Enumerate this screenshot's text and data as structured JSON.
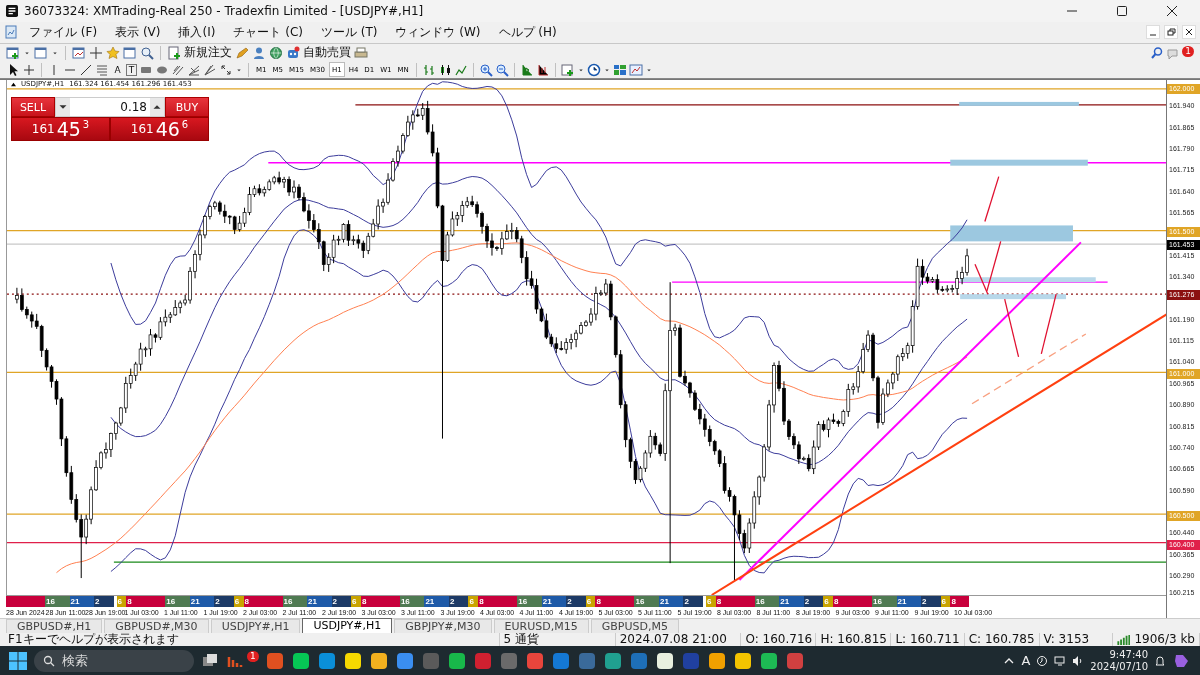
{
  "window": {
    "title": "36073324: XMTrading-Real 250 - Tradexfin Limited - [USDJPY#,H1]"
  },
  "menu": [
    "ファイル (F)",
    "表示 (V)",
    "挿入(I)",
    "チャート (C)",
    "ツール (T)",
    "ウィンドウ (W)",
    "ヘルプ (H)"
  ],
  "toolbar": {
    "new_order": "新規注文",
    "auto_trading": "自動売買",
    "notification_count": "1"
  },
  "tools": {
    "text_tool": "A",
    "label_tool": "T"
  },
  "timeframes": [
    {
      "label": "M1",
      "selected": false
    },
    {
      "label": "M5",
      "selected": false
    },
    {
      "label": "M15",
      "selected": false
    },
    {
      "label": "M30",
      "selected": false
    },
    {
      "label": "H1",
      "selected": true
    },
    {
      "label": "H4",
      "selected": false
    },
    {
      "label": "D1",
      "selected": false
    },
    {
      "label": "W1",
      "selected": false
    },
    {
      "label": "MN",
      "selected": false
    }
  ],
  "chart": {
    "header": {
      "symbol": "USDJPY#,H1",
      "ohlc": "161.324 161.454 161.296 161.453"
    },
    "trade_panel": {
      "sell": "SELL",
      "buy": "BUY",
      "lot": "0.18",
      "sell_price": {
        "prefix": "161",
        "main": "45",
        "suffix": "3"
      },
      "buy_price": {
        "prefix": "161",
        "main": "46",
        "suffix": "6"
      }
    },
    "price_labels": [
      "161.940",
      "161.865",
      "161.790",
      "161.715",
      "161.640",
      "161.565",
      "161.415",
      "161.340",
      "161.190",
      "161.115",
      "161.040",
      "160.965",
      "160.890",
      "160.815",
      "160.740",
      "160.665",
      "160.590",
      "160.440",
      "160.365",
      "160.290",
      "160.215"
    ],
    "levels": [
      {
        "label": "162.000",
        "color": "#e0a526",
        "kind": "solid"
      },
      {
        "label": "161.500",
        "color": "#e0a526",
        "kind": "solid"
      },
      {
        "label": "161.453",
        "color": "#000000",
        "kind": "bid"
      },
      {
        "label": "161.276",
        "color": "#8b1010",
        "kind": "dotted"
      },
      {
        "label": "161.000",
        "color": "#e0a526",
        "kind": "solid"
      },
      {
        "label": "160.500",
        "color": "#e0a526",
        "kind": "solid"
      },
      {
        "label": "160.400",
        "color": "#e0204a",
        "kind": "solid"
      }
    ],
    "time_labels": [
      "28 Jun 2024",
      "28 Jun 11:00",
      "28 Jun 19:00",
      "1 Jul 03:00",
      "1 Jul 11:00",
      "1 Jul 19:00",
      "2 Jul 03:00",
      "2 Jul 11:00",
      "2 Jul 19:00",
      "3 Jul 03:00",
      "3 Jul 11:00",
      "3 Jul 19:00",
      "4 Jul 03:00",
      "4 Jul 11:00",
      "4 Jul 19:00",
      "5 Jul 03:00",
      "5 Jul 11:00",
      "5 Jul 19:00",
      "8 Jul 03:00",
      "8 Jul 11:00",
      "8 Jul 19:00",
      "9 Jul 03:00",
      "9 Jul 11:00",
      "9 Jul 19:00",
      "10 Jul 03:00"
    ],
    "sessions": [
      {
        "kind": "eu",
        "color": "#c8003c"
      },
      {
        "kind": "us",
        "color": "#4f7a52",
        "label": "16"
      },
      {
        "kind": "late",
        "color": "#1e5aa8",
        "label": "21"
      },
      {
        "kind": "asia",
        "color": "#1d3a66",
        "label": "2"
      },
      {
        "kind": "gap"
      },
      {
        "kind": "pre",
        "color": "#c9a400",
        "label": "6"
      },
      {
        "kind": "eu",
        "color": "#c8003c",
        "label": "8"
      },
      {
        "kind": "us",
        "color": "#4f7a52",
        "label": "16"
      },
      {
        "kind": "late",
        "color": "#1e5aa8",
        "label": "21"
      },
      {
        "kind": "asia",
        "color": "#1d3a66",
        "label": "2"
      },
      {
        "kind": "pre",
        "color": "#c9a400",
        "label": "6"
      },
      {
        "kind": "eu",
        "color": "#c8003c",
        "label": "8"
      },
      {
        "kind": "us",
        "color": "#4f7a52",
        "label": "16"
      },
      {
        "kind": "late",
        "color": "#1e5aa8",
        "label": "21"
      },
      {
        "kind": "asia",
        "color": "#1d3a66",
        "label": "2"
      },
      {
        "kind": "pre",
        "color": "#c9a400",
        "label": "6"
      },
      {
        "kind": "eu",
        "color": "#c8003c",
        "label": "8"
      },
      {
        "kind": "us",
        "color": "#4f7a52",
        "label": "16"
      },
      {
        "kind": "late",
        "color": "#1e5aa8",
        "label": "21"
      },
      {
        "kind": "asia",
        "color": "#1d3a66",
        "label": "2"
      },
      {
        "kind": "pre",
        "color": "#c9a400",
        "label": "6"
      },
      {
        "kind": "eu",
        "color": "#c8003c",
        "label": "8"
      },
      {
        "kind": "us",
        "color": "#4f7a52",
        "label": "16"
      },
      {
        "kind": "late",
        "color": "#1e5aa8",
        "label": "21"
      },
      {
        "kind": "asia",
        "color": "#1d3a66",
        "label": "2"
      },
      {
        "kind": "pre",
        "color": "#c9a400",
        "label": "6"
      },
      {
        "kind": "eu",
        "color": "#c8003c",
        "label": "8"
      },
      {
        "kind": "us",
        "color": "#4f7a52",
        "label": "16"
      },
      {
        "kind": "late",
        "color": "#1e5aa8",
        "label": "21"
      },
      {
        "kind": "asia",
        "color": "#1d3a66",
        "label": "2"
      },
      {
        "kind": "gap"
      },
      {
        "kind": "pre",
        "color": "#c9a400",
        "label": "6"
      },
      {
        "kind": "eu",
        "color": "#c8003c",
        "label": "8"
      },
      {
        "kind": "us",
        "color": "#4f7a52",
        "label": "16"
      },
      {
        "kind": "late",
        "color": "#1e5aa8",
        "label": "21"
      },
      {
        "kind": "asia",
        "color": "#1d3a66",
        "label": "2"
      },
      {
        "kind": "pre",
        "color": "#c9a400",
        "label": "6"
      },
      {
        "kind": "eu",
        "color": "#c8003c",
        "label": "8"
      },
      {
        "kind": "us",
        "color": "#4f7a52",
        "label": "16"
      },
      {
        "kind": "late",
        "color": "#1e5aa8",
        "label": "21"
      },
      {
        "kind": "asia",
        "color": "#1d3a66",
        "label": "2"
      },
      {
        "kind": "pre",
        "color": "#c9a400",
        "label": "6"
      },
      {
        "kind": "open",
        "color": "#c8003c",
        "label": "8"
      }
    ]
  },
  "tabs": [
    {
      "label": "GBPUSD#,H1",
      "selected": false
    },
    {
      "label": "GBPUSD#,M30",
      "selected": false
    },
    {
      "label": "USDJPY#,H1",
      "selected": false
    },
    {
      "label": "USDJPY#,H1",
      "selected": true
    },
    {
      "label": "GBPJPY#,M30",
      "selected": false
    },
    {
      "label": "EURUSD,M15",
      "selected": false
    },
    {
      "label": "GBPUSD,M5",
      "selected": false
    }
  ],
  "status_bar": {
    "help": "F1キーでヘルプが表示されます",
    "profile": "5 通貨",
    "datetime": "2024.07.08 21:00",
    "open": "O: 160.716",
    "high": "H: 160.815",
    "low": "L: 160.711",
    "close": "C: 160.785",
    "volume": "V: 3153",
    "traffic": "1906/3 kb"
  },
  "taskbar": {
    "search_placeholder": "検索",
    "badge": "1",
    "ime": "A",
    "time": "9:47:40",
    "date": "2024/07/10"
  }
}
